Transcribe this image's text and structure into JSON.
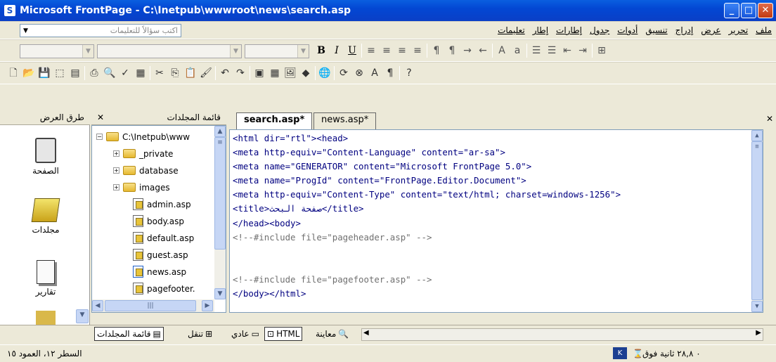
{
  "window": {
    "title": "Microsoft FrontPage - C:\\Inetpub\\wwwroot\\news\\search.asp"
  },
  "menu": {
    "ask_placeholder": "اكتب سؤالاً للتعليمات",
    "items": [
      "ملف",
      "تحرير",
      "عرض",
      "إدراج",
      "تنسيق",
      "أدوات",
      "جدول",
      "إطارات",
      "إطار",
      "تعليمات"
    ]
  },
  "views": {
    "header": "طرق العرض",
    "items": [
      "الصفحة",
      "مجلدات",
      "تقارير"
    ]
  },
  "folders": {
    "header": "قائمة المجلدات",
    "root": "C:\\Inetpub\\www",
    "items": [
      "_private",
      "database",
      "images",
      "admin.asp",
      "body.asp",
      "default.asp",
      "guest.asp",
      "news.asp",
      "pagefooter."
    ]
  },
  "tabs": [
    "search.asp*",
    "news.asp*"
  ],
  "code": [
    [
      "<html dir=\"rtl\"><head>"
    ],
    [
      "<meta http-equiv=\"Content-Language\" content=\"ar-sa\">"
    ],
    [
      "<meta name=\"GENERATOR\" content=\"Microsoft FrontPage 5.0\">"
    ],
    [
      "<meta name=\"ProgId\" content=\"FrontPage.Editor.Document\">"
    ],
    [
      "<meta http-equiv=\"Content-Type\" content=\"text/html; charset=windows-1256\">"
    ],
    [
      "<title>صفحة البحث</title>"
    ],
    [
      "</head><body>"
    ],
    [
      "<!--#include file=\"pageheader.asp\" -->"
    ],
    [
      ""
    ],
    [
      ""
    ],
    [
      "<!--#include file=\"pagefooter.asp\" -->"
    ],
    [
      "</body></html>"
    ]
  ],
  "bottom": {
    "folder_list": "قائمة المجلدات",
    "navigation": "تنقل",
    "normal": "عادي",
    "html": "HTML",
    "preview": "معاينة"
  },
  "status": {
    "position": "السطر ١٢، العمود ١٥",
    "timing": "٠ ٢٨,٨ ثانية فوق"
  }
}
